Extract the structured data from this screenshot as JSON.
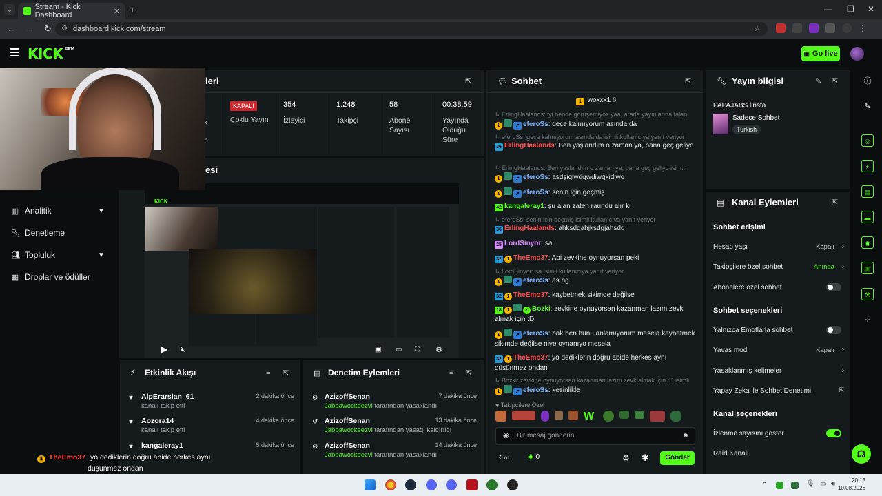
{
  "browser": {
    "tab_title": "Stream - Kick Dashboard",
    "url": "dashboard.kick.com/stream"
  },
  "header": {
    "logo": "KICK",
    "beta": "BETA",
    "go_live": "Go live"
  },
  "sidebar": {
    "items": [
      {
        "label": "Analitik",
        "icon": "chart-icon",
        "expandable": true
      },
      {
        "label": "Denetleme",
        "icon": "wrench-icon",
        "expandable": false
      },
      {
        "label": "Topluluk",
        "icon": "users-icon",
        "expandable": true
      },
      {
        "label": "Droplar ve ödüller",
        "icon": "gift-icon",
        "expandable": false
      }
    ]
  },
  "stats": {
    "title_fragment": "leri",
    "cells": [
      {
        "value": "KAPALI",
        "label": "Çoklu Yayın"
      },
      {
        "value": "354",
        "label": "İzleyici"
      },
      {
        "value": "1.248",
        "label": "Takipçi"
      },
      {
        "value": "58",
        "label": "Abone Sayısı"
      },
      {
        "value": "00:38:59",
        "label": "Yayında Olduğu Süre"
      }
    ],
    "partial_k": "k",
    "partial_n": "n"
  },
  "preview": {
    "title_fragment": "esi"
  },
  "activity": {
    "title": "Etkinlik Akışı",
    "items": [
      {
        "user": "AlpErarslan_61",
        "desc": "kanalı takip etti",
        "time": "2 dakika önce"
      },
      {
        "user": "Aozora14",
        "desc": "kanalı takip etti",
        "time": "4 dakika önce"
      },
      {
        "user": "kangaleray1",
        "desc": "",
        "time": "5 dakika önce"
      }
    ]
  },
  "moderation": {
    "title": "Denetim Eylemleri",
    "items": [
      {
        "user": "AzizoffSenan",
        "actor": "Jabbawockeezvl",
        "desc": "tarafından yasaklandı",
        "time": "7 dakika önce"
      },
      {
        "user": "AzizoffSenan",
        "actor": "Jabbawockeezvl",
        "desc": "tarafından yasağı kaldırıldı",
        "time": "13 dakika önce"
      },
      {
        "user": "AzizoffSenan",
        "actor": "Jabbawockeezvl",
        "desc": "tarafından yasaklandı",
        "time": "14 dakika önce"
      }
    ]
  },
  "chat": {
    "title": "Sohbet",
    "pinned_user": "woxxx1",
    "pinned_count": "6",
    "input_placeholder": "Bir mesaj gönderin",
    "send": "Gönder",
    "followers_only_label": "Takipçilere Özel",
    "points": "0",
    "messages": [
      {
        "type": "ctx",
        "text": "ErlingHaalands: iyi bende görüşemiyoz yaa, arada yayınlarına falan gel..."
      },
      {
        "type": "msg",
        "badges": [
          "g1",
          "leaf",
          "arrow"
        ],
        "user": "eferoSs",
        "color": "#7fb4ff",
        "text": "geçe kalmıyorum asında da"
      },
      {
        "type": "ctx",
        "text": "eferoSs: geçe kalmıyorum asında da isimli kullanıcıya yanıt veriyor"
      },
      {
        "type": "msg",
        "badges": [
          "b36"
        ],
        "user": "ErlingHaalands",
        "color": "#ff4d4d",
        "text": "Ben yaşlandım o zaman ya, bana geç geliyo"
      },
      {
        "type": "ctx",
        "text": "ErlingHaalands: Ben yaşlandım o zaman ya, bana geç geliyo isim..."
      },
      {
        "type": "msg",
        "badges": [
          "g1",
          "leaf",
          "arrow"
        ],
        "user": "eferoSs",
        "color": "#7fb4ff",
        "text": "asdşiqiwdqwdiwqkidjwq"
      },
      {
        "type": "msg",
        "badges": [
          "g1",
          "leaf",
          "arrow"
        ],
        "user": "eferoSs",
        "color": "#7fb4ff",
        "text": "senin için geçmiş"
      },
      {
        "type": "msg",
        "badges": [
          "b42"
        ],
        "user": "kangaleray1",
        "color": "#53fc18",
        "text": "şu alan zaten raundu alır ki"
      },
      {
        "type": "ctx",
        "text": "eferoSs: senin için geçmiş isimli kullanıcıya yanıt veriyor"
      },
      {
        "type": "msg",
        "badges": [
          "b36"
        ],
        "user": "ErlingHaalands",
        "color": "#ff4d4d",
        "text": "ahksdgahjksdgjahsdg"
      },
      {
        "type": "msg",
        "badges": [
          "b25"
        ],
        "user": "LordSinyor",
        "color": "#d88bff",
        "text": "sa"
      },
      {
        "type": "msg",
        "badges": [
          "b32",
          "g1"
        ],
        "user": "TheEmo37",
        "color": "#ff4d4d",
        "text": "Abi zevkine oynuyorsan peki"
      },
      {
        "type": "ctx",
        "text": "LordSinyor: sa isimli kullanıcıya yanıt veriyor"
      },
      {
        "type": "msg",
        "badges": [
          "g1",
          "leaf",
          "arrow"
        ],
        "user": "eferoSs",
        "color": "#7fb4ff",
        "text": "as hg"
      },
      {
        "type": "msg",
        "badges": [
          "b32",
          "g1"
        ],
        "user": "TheEmo37",
        "color": "#ff4d4d",
        "text": "kaybetmek sikimde değilse"
      },
      {
        "type": "msg",
        "badges": [
          "b18",
          "g1",
          "leaf",
          "check"
        ],
        "user": "Bozki",
        "color": "#53fc18",
        "text": "zevkine oynuyorsan kazanman lazım zevk almak için :D"
      },
      {
        "type": "msg",
        "badges": [
          "g1",
          "leaf",
          "arrow"
        ],
        "user": "eferoSs",
        "color": "#7fb4ff",
        "text": "bak ben bunu anlamıyorum mesela kaybetmek sikimde değilse niye oynanıyo mesela"
      },
      {
        "type": "msg",
        "badges": [
          "b32",
          "g1"
        ],
        "user": "TheEmo37",
        "color": "#ff4d4d",
        "text": "yo dediklerin doğru abide herkes aynı düşünmez ondan"
      },
      {
        "type": "ctx",
        "text": "Bozki: zevkine oynuyorsan kazanman lazım zevk almak için :D isimli k..."
      },
      {
        "type": "msg",
        "badges": [
          "g1",
          "leaf",
          "arrow"
        ],
        "user": "eferoSs",
        "color": "#7fb4ff",
        "text": "kesinlikle"
      }
    ]
  },
  "stream_info": {
    "title": "Yayın bilgisi",
    "stream_title": "PAPAJABS linsta",
    "category": "Sadece Sohbet",
    "tag": "Turkish"
  },
  "channel_actions": {
    "title": "Kanal Eylemleri",
    "sections": [
      {
        "heading": "Sohbet erişimi",
        "rows": [
          {
            "label": "Hesap yaşı",
            "value": "Kapalı",
            "control": "chevron"
          },
          {
            "label": "Takipçilere özel sohbet",
            "value": "Anında",
            "control": "chevron",
            "accent": true
          },
          {
            "label": "Abonelere özel sohbet",
            "value": "",
            "control": "toggle",
            "on": false
          }
        ]
      },
      {
        "heading": "Sohbet seçenekleri",
        "rows": [
          {
            "label": "Yalnızca Emotlarla sohbet",
            "value": "",
            "control": "toggle",
            "on": false
          },
          {
            "label": "Yavaş mod",
            "value": "Kapalı",
            "control": "chevron"
          },
          {
            "label": "Yasaklanmış kelimeler",
            "value": "",
            "control": "chevron"
          },
          {
            "label": "Yapay Zeka ile Sohbet Denetimi",
            "value": "",
            "control": "external"
          }
        ]
      },
      {
        "heading": "Kanal seçenekleri",
        "rows": [
          {
            "label": "İzlenme sayısını göster",
            "value": "",
            "control": "toggle",
            "on": true
          },
          {
            "label": "Raid Kanalı",
            "value": "",
            "control": "none"
          }
        ]
      }
    ]
  },
  "overlay": {
    "badge": "1",
    "user": "TheEmo37",
    "line1": "yo dediklerin doğru abide herkes aynı",
    "line2": "düşünmez ondan"
  },
  "taskbar": {
    "time": "20:13",
    "date": "10.08.2026"
  },
  "colors": {
    "accent": "#53fc18",
    "panel": "#151a1c",
    "background": "#0b0e0f",
    "live_off": "#d0262b"
  }
}
